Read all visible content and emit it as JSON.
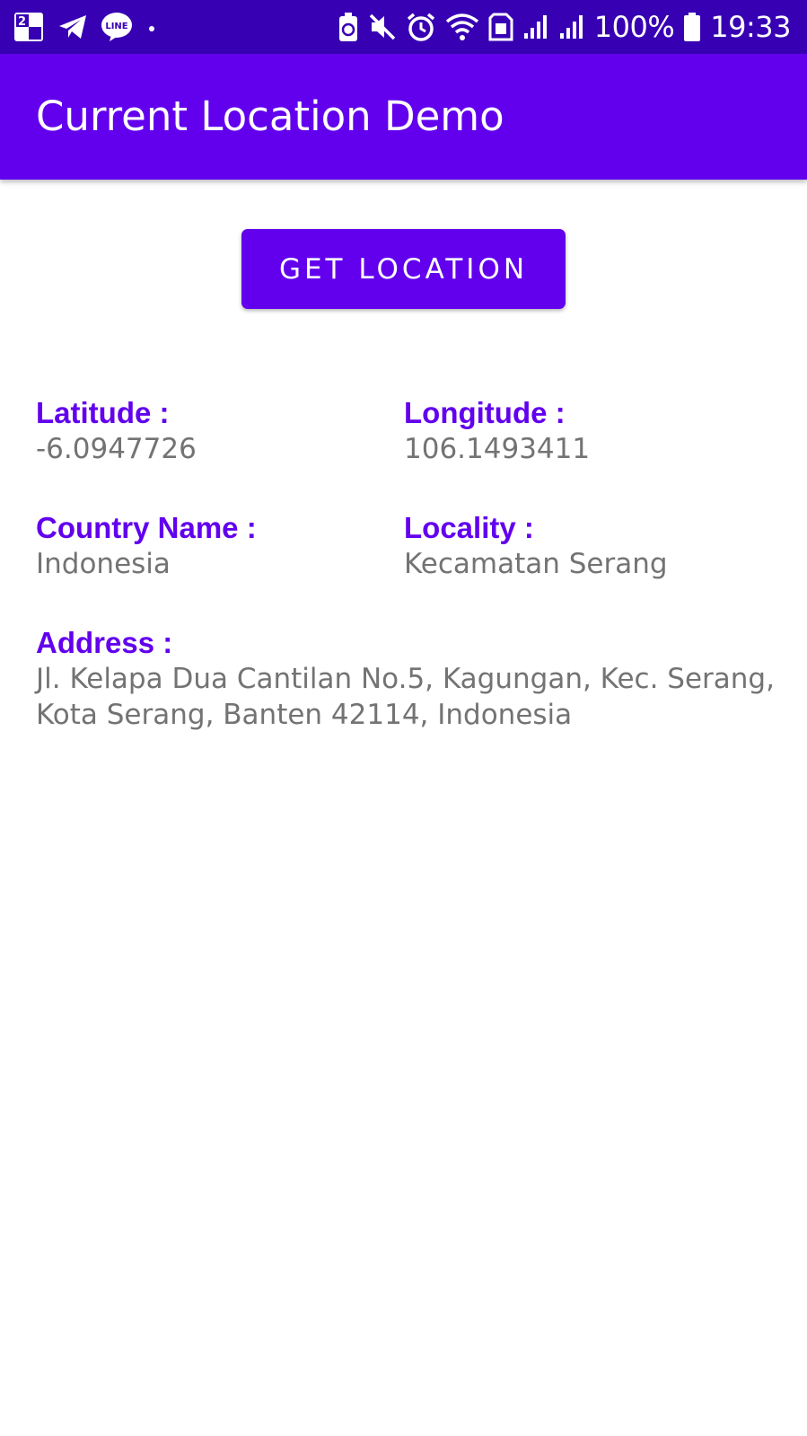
{
  "status_bar": {
    "left_icons": [
      "calendar-icon",
      "telegram-icon",
      "line-icon",
      "dot-icon"
    ],
    "calendar_badge": "2",
    "line_label": "LINE",
    "right_icons": [
      "battery-saver-icon",
      "mute-icon",
      "alarm-icon",
      "wifi-icon",
      "sim-icon",
      "signal-icon",
      "signal-icon",
      "battery-icon"
    ],
    "battery_percent": "100%",
    "time": "19:33",
    "color": "#3700b3"
  },
  "app_bar": {
    "title": "Current Location Demo",
    "color": "#6200ee"
  },
  "button": {
    "label": "GET LOCATION",
    "color": "#6200ee"
  },
  "fields": {
    "latitude": {
      "label": "Latitude :",
      "value": "-6.0947726"
    },
    "longitude": {
      "label": "Longitude :",
      "value": "106.1493411"
    },
    "country": {
      "label": "Country Name :",
      "value": "Indonesia"
    },
    "locality": {
      "label": "Locality :",
      "value": "Kecamatan Serang"
    },
    "address": {
      "label": "Address :",
      "value": "Jl. Kelapa Dua Cantilan No.5, Kagungan, Kec. Serang, Kota Serang, Banten 42114, Indonesia"
    }
  },
  "colors": {
    "label": "#6200ee",
    "value": "#737373"
  }
}
